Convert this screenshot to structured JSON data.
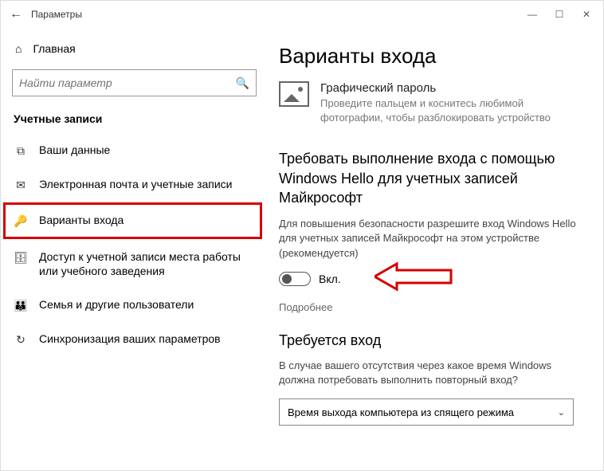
{
  "titlebar": {
    "back_glyph": "←",
    "title": "Параметры",
    "min_glyph": "—",
    "max_glyph": "☐",
    "close_glyph": "✕"
  },
  "sidebar": {
    "home_icon": "⌂",
    "home_label": "Главная",
    "search_placeholder": "Найти параметр",
    "search_icon": "🔍",
    "section_title": "Учетные записи",
    "items": [
      {
        "icon": "⧉",
        "label": "Ваши данные"
      },
      {
        "icon": "✉",
        "label": "Электронная почта и учетные записи"
      },
      {
        "icon": "🔑",
        "label": "Варианты входа"
      },
      {
        "icon": "🗄",
        "label": "Доступ к учетной записи места работы или учебного заведения"
      },
      {
        "icon": "👪",
        "label": "Семья и другие пользователи"
      },
      {
        "icon": "↻",
        "label": "Синхронизация ваших параметров"
      }
    ]
  },
  "main": {
    "page_title": "Варианты входа",
    "picture_password": {
      "title": "Графический пароль",
      "desc": "Проведите пальцем и коснитесь любимой фотографии, чтобы разблокировать устройство"
    },
    "hello_section": {
      "heading": "Требовать выполнение входа с помощью Windows Hello для учетных записей Майкрософт",
      "body": "Для повышения безопасности разрешите вход Windows Hello для учетных записей Майкрософт на этом устройстве (рекомендуется)",
      "toggle_state_label": "Вкл.",
      "learn_more": "Подробнее"
    },
    "require_signin": {
      "heading": "Требуется вход",
      "body": "В случае вашего отсутствия через какое время Windows должна потребовать выполнить повторный вход?",
      "dropdown_value": "Время выхода компьютера из спящего режима",
      "chevron": "⌄"
    }
  }
}
